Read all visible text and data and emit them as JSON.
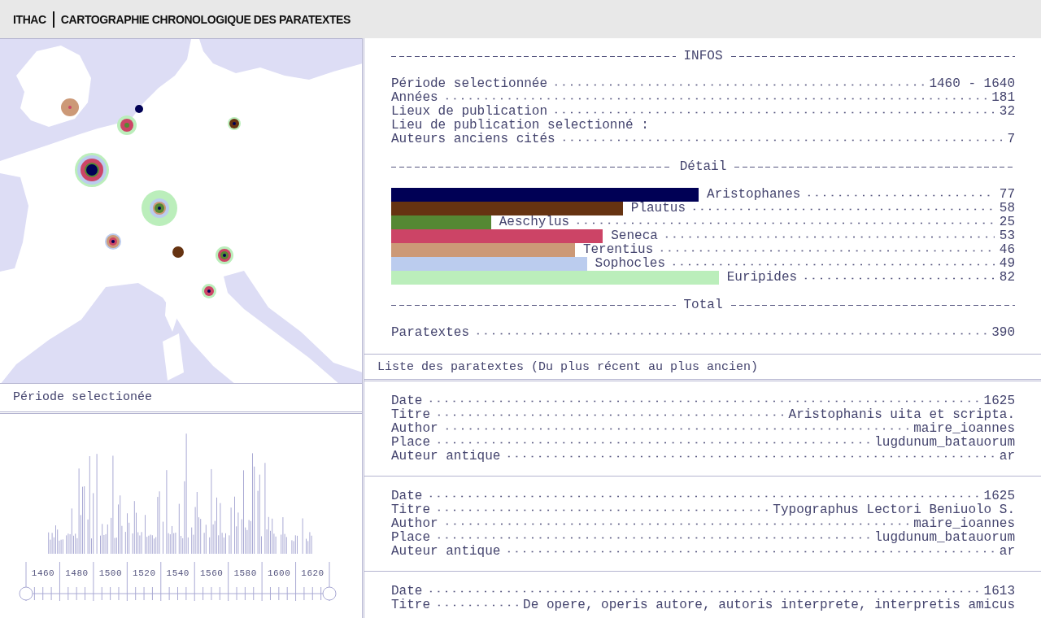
{
  "header": {
    "logo": "ITHAC",
    "title": "CARTOGRAPHIE CHRONOLOGIQUE DES PARATEXTES"
  },
  "period_label": "Période selectionée",
  "timeline": {
    "axis_labels": [
      "1460",
      "1480",
      "1500",
      "1520",
      "1540",
      "1560",
      "1580",
      "1600",
      "1620"
    ]
  },
  "infos": {
    "title": "INFOS",
    "rows": [
      {
        "label": "Période selectionnée",
        "value": "1460 - 1640"
      },
      {
        "label": "Années",
        "value": "181"
      },
      {
        "label": "Lieux de publication",
        "value": "32"
      },
      {
        "label": "Lieu de publication selectionné :"
      },
      {
        "label": "Auteurs anciens cités",
        "value": "7"
      }
    ]
  },
  "detail": {
    "title": "Détail",
    "authors": [
      {
        "name": "Aristophanes",
        "count": "77",
        "color": "#000055"
      },
      {
        "name": "Plautus",
        "count": "58",
        "color": "#663311"
      },
      {
        "name": "Aeschylus",
        "count": "25",
        "color": "#558833"
      },
      {
        "name": "Seneca",
        "count": "53",
        "color": "#cc4466"
      },
      {
        "name": "Terentius",
        "count": "46",
        "color": "#cc9977"
      },
      {
        "name": "Sophocles",
        "count": "49",
        "color": "#bbccee"
      },
      {
        "name": "Euripides",
        "count": "82",
        "color": "#bbeebb"
      }
    ]
  },
  "total": {
    "title": "Total",
    "rows": [
      {
        "label": "Paratextes",
        "value": "390"
      }
    ]
  },
  "list": {
    "title": "Liste des paratextes (Du plus récent au plus ancien)",
    "entries": [
      {
        "fields": [
          {
            "label": "Date",
            "value": "1625"
          },
          {
            "label": "Titre",
            "value": "Aristophanis uita et scripta."
          },
          {
            "label": "Author",
            "value": "maire_ioannes"
          },
          {
            "label": "Place",
            "value": "lugdunum_batauorum"
          },
          {
            "label": "Auteur antique",
            "value": "ar"
          }
        ]
      },
      {
        "fields": [
          {
            "label": "Date",
            "value": "1625"
          },
          {
            "label": "Titre",
            "value": "Typographus Lectori Beniuolo S."
          },
          {
            "label": "Author",
            "value": "maire_ioannes"
          },
          {
            "label": "Place",
            "value": "lugdunum_batauorum"
          },
          {
            "label": "Auteur antique",
            "value": "ar"
          }
        ]
      },
      {
        "fields": [
          {
            "label": "Date",
            "value": "1613"
          },
          {
            "label": "Titre",
            "value": "De opere, operis autore, autoris interprete, interpretis amicus"
          }
        ]
      }
    ]
  }
}
